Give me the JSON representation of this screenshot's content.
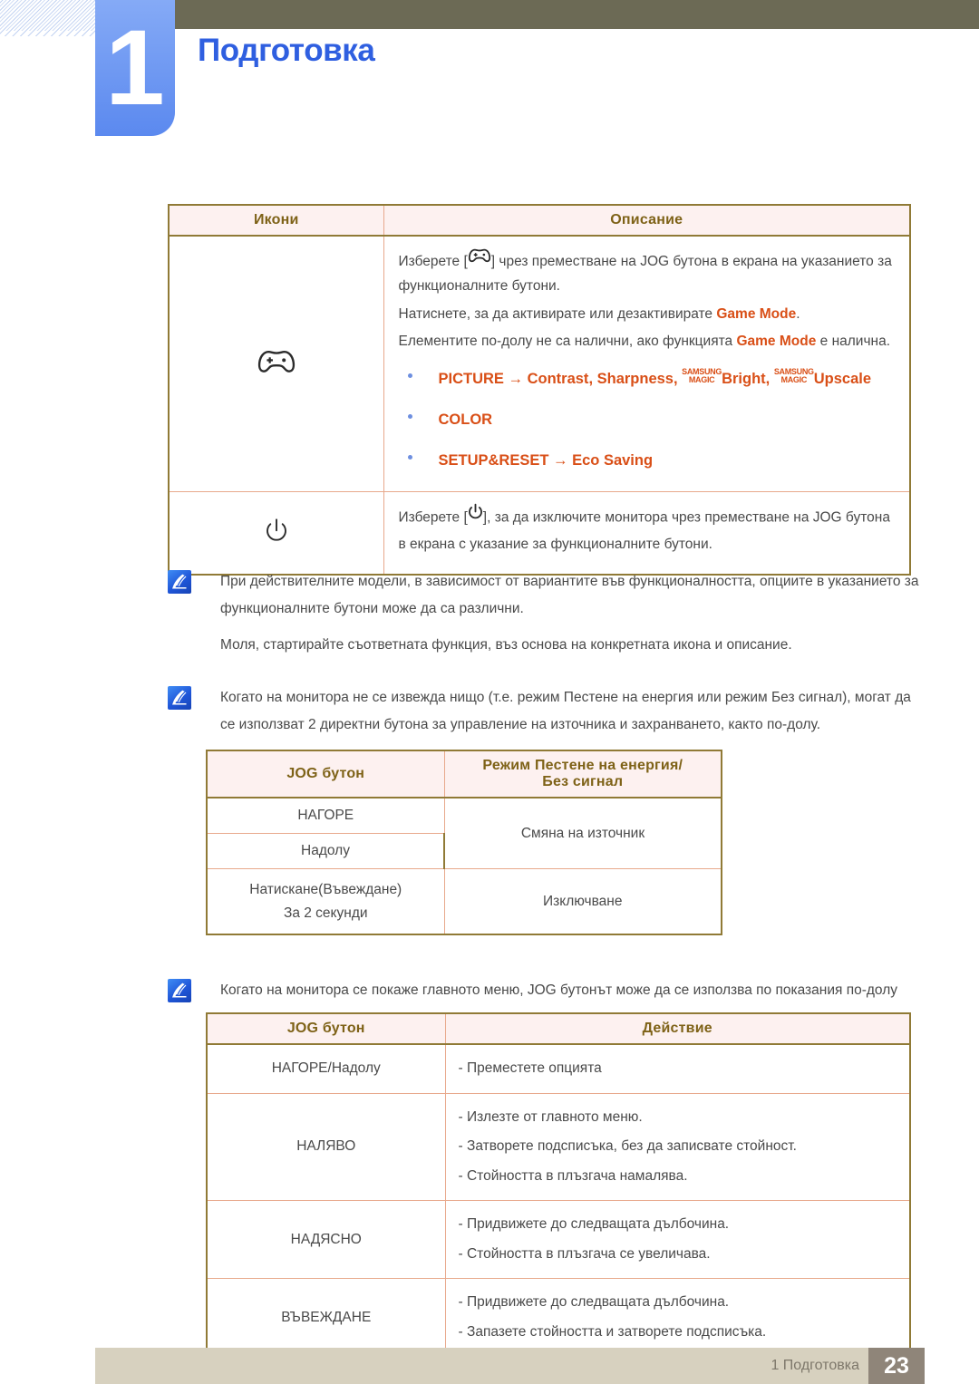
{
  "header": {
    "chapter_number": "1",
    "chapter_title": "Подготовка"
  },
  "table_icons": {
    "columns": [
      "Икони",
      "Описание"
    ],
    "rows": [
      {
        "icon": "gamepad-icon",
        "lines": [
          "Изберете [ ] чрез преместване на JOG бутона в екрана на указанието за функционалните бутони.",
          "Натиснете, за да активирате или дезактивирате Game Mode.",
          "Елементите по-долу не са налични, ако функцията Game Mode е налична."
        ],
        "line1_pre": "Изберете [",
        "line1_post": "] чрез преместване на JOG бутона в екрана на",
        "line1_cont": "указанието за функционалните бутони.",
        "line2_pre": "Натиснете, за да активирате или дезактивирате ",
        "line2_em": "Game Mode",
        "line2_post": ".",
        "line3_pre": "Елементите по-долу не са налични, ако функцията ",
        "line3_em": "Game Mode",
        "line3_post": " е",
        "line3_cont": "налична.",
        "bullets": [
          {
            "parts": [
              "PICTURE",
              " → ",
              "Contrast",
              ", ",
              "Sharpness",
              ", "
            ],
            "magic1_top": "SAMSUNG",
            "magic1_bottom": "MAGIC",
            "after_magic1": "Bright",
            "sep": ", ",
            "magic2_top": "SAMSUNG",
            "magic2_bottom": "MAGIC",
            "after_magic2": "Upscale"
          },
          {
            "text": "COLOR"
          },
          {
            "text": "SETUP&RESET → Eco Saving"
          }
        ]
      },
      {
        "icon": "power-icon",
        "line1_pre": "Изберете [",
        "line1_post": "], за да изключите монитора чрез преместване на JOG",
        "line1_cont": "бутона в екрана с указание за функционалните бутони."
      }
    ]
  },
  "notes": [
    {
      "icon": "note-icon",
      "paragraphs": [
        "При действителните модели, в зависимост от вариантите във функционалността, опциите в указанието за функционалните бутони може да са различни.",
        "Моля, стартирайте съответната функция, въз основа на конкретната икона и описание."
      ]
    },
    {
      "icon": "note-icon",
      "paragraphs": [
        "Когато на монитора не се извежда нищо (т.е. режим Пестене на енергия или режим Без сигнал), могат да се използват 2 директни бутона за управление на източника и захранването, както по-долу."
      ]
    },
    {
      "icon": "note-icon",
      "paragraphs": [
        "Когато на монитора се покаже главното меню, JOG бутонът може да се използва по показания по-долу начин."
      ]
    }
  ],
  "table_power": {
    "columns": [
      "JOG бутон",
      "Режим Пестене на енергия/\nБез сигнал"
    ],
    "col2_line1": "Режим Пестене на енергия/",
    "col2_line2": "Без сигнал",
    "rows": [
      {
        "key": "НАГОРЕ",
        "value": "Смяна на източник"
      },
      {
        "key": "Надолу",
        "value": ""
      },
      {
        "key_line1": "Натискане(Въвеждане)",
        "key_line2": "За 2 секунди",
        "value": "Изключване"
      }
    ]
  },
  "table_menu": {
    "columns": [
      "JOG бутон",
      "Действие"
    ],
    "rows": [
      {
        "key": "НАГОРЕ/Надолу",
        "actions": [
          "- Преместете опцията"
        ]
      },
      {
        "key": "НАЛЯВО",
        "actions": [
          "- Излезте от главното меню.",
          "- Затворете подсписъка, без да записвате стойност.",
          "- Стойността в плъзгача намалява."
        ]
      },
      {
        "key": "НАДЯСНО",
        "actions": [
          "- Придвижете до следващата дълбочина.",
          "- Стойността в плъзгача се увеличава."
        ]
      },
      {
        "key": "ВЪВЕЖДАНЕ",
        "actions": [
          "- Придвижете до следващата дълбочина.",
          "- Запазете стойността и затворете подсписъка."
        ]
      }
    ]
  },
  "footer": {
    "text": "1 Подготовка",
    "page": "23"
  },
  "colors": {
    "accent_orange": "#d94f17",
    "header_gold": "#7e6217",
    "table_border": "#907a36",
    "table_inner_border": "#e8a98c",
    "table_head_bg": "#fdf1f0",
    "chapter_blue": "#2f5fe0",
    "olive_bar": "#6c6a55",
    "footer_bg": "#d7d1bf",
    "page_badge_bg": "#8f8579"
  }
}
